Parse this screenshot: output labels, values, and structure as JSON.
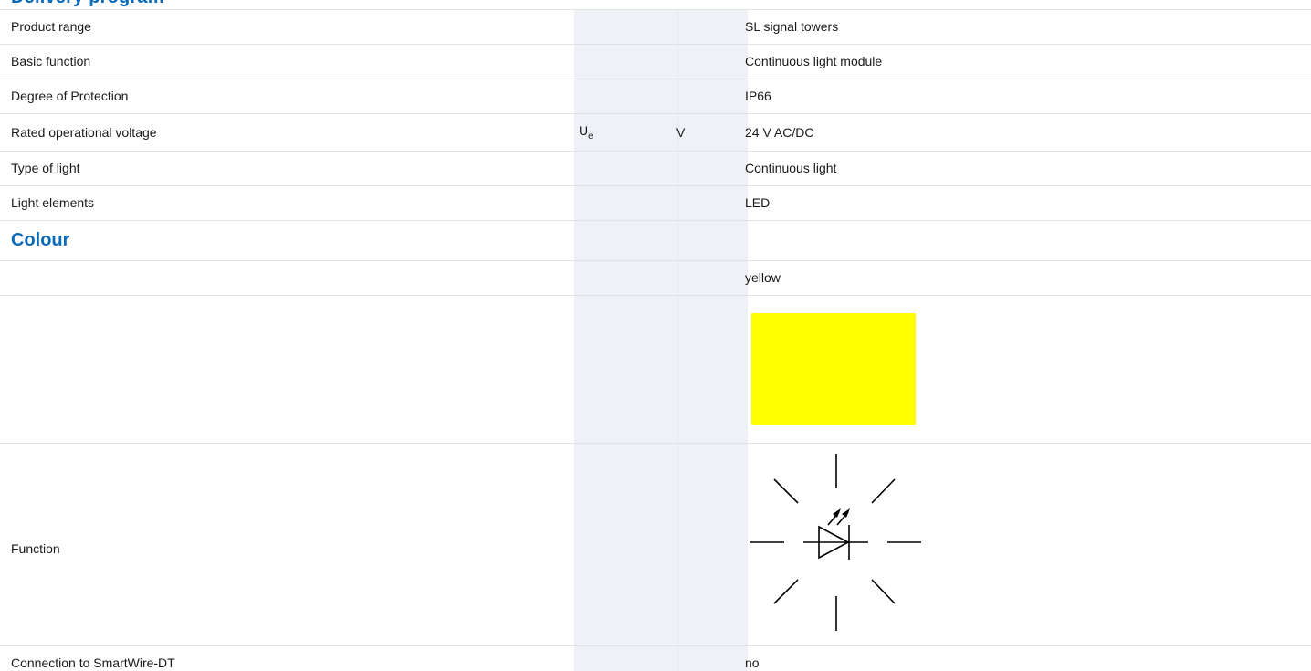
{
  "header": {
    "cut_heading": "Delivery program"
  },
  "rows": {
    "product_range": {
      "label": "Product range",
      "value": "SL signal towers"
    },
    "basic_function": {
      "label": "Basic function",
      "value": "Continuous light module"
    },
    "degree_of_protection": {
      "label": "Degree of Protection",
      "value": "IP66"
    },
    "rated_voltage": {
      "label": "Rated operational voltage",
      "symbol_main": "U",
      "symbol_sub": "e",
      "unit": "V",
      "value": "24 V AC/DC"
    },
    "type_of_light": {
      "label": "Type of light",
      "value": "Continuous light"
    },
    "light_elements": {
      "label": "Light elements",
      "value": "LED"
    },
    "colour_section": {
      "title": "Colour"
    },
    "colour_value": {
      "value": "yellow"
    },
    "colour_swatch": {
      "color": "#ffff00"
    },
    "function": {
      "label": "Function",
      "symbol_icon": "led-continuous-light-symbol-icon"
    },
    "smartwire": {
      "label": "Connection to SmartWire-DT",
      "value": "no"
    }
  }
}
